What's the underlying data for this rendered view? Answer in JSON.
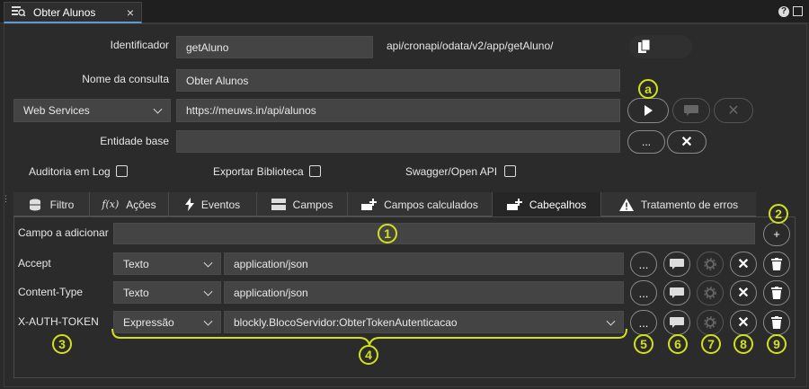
{
  "tab": {
    "title": "Obter Alunos",
    "close_icon": "close-icon"
  },
  "header_icons": {
    "help": "?"
  },
  "form": {
    "identificador_label": "Identificador",
    "identificador_value": "getAluno",
    "api_path": "api/cronapi/odata/v2/app/getAluno/",
    "nome_label": "Nome da consulta",
    "nome_value": "Obter Alunos",
    "source_type": "Web Services",
    "url_value": "https://meuws.in/api/alunos",
    "entidade_label": "Entidade base",
    "entidade_value": "",
    "dots": "...",
    "auditoria_label": "Auditoria em Log",
    "exportar_label": "Exportar Biblioteca",
    "swagger_label": "Swagger/Open API"
  },
  "tabs": [
    {
      "label": "Filtro",
      "icon": "database-icon"
    },
    {
      "label": "Ações",
      "icon": "function-icon"
    },
    {
      "label": "Eventos",
      "icon": "lightning-icon"
    },
    {
      "label": "Campos",
      "icon": "table-icon"
    },
    {
      "label": "Campos calculados",
      "icon": "add-field-icon"
    },
    {
      "label": "Cabeçalhos",
      "icon": "add-field-icon"
    },
    {
      "label": "Tratamento de erros",
      "icon": "warning-icon"
    }
  ],
  "headers": {
    "add_label": "Campo a adicionar",
    "add_value": "",
    "add_button": "+",
    "rows": [
      {
        "name": "Accept",
        "type": "Texto",
        "value": "application/json"
      },
      {
        "name": "Content-Type",
        "type": "Texto",
        "value": "application/json"
      },
      {
        "name": "X-AUTH-TOKEN",
        "type": "Expressão",
        "value": "blockly.BlocoServidor:ObterTokenAutenticacao"
      }
    ],
    "row_dots": "..."
  },
  "annotations": {
    "a": "a",
    "n1": "1",
    "n2": "2",
    "n3": "3",
    "n4": "4",
    "n5": "5",
    "n6": "6",
    "n7": "7",
    "n8": "8",
    "n9": "9"
  },
  "colors": {
    "accent": "#5b9bd5",
    "annotation": "#d4e11a"
  }
}
